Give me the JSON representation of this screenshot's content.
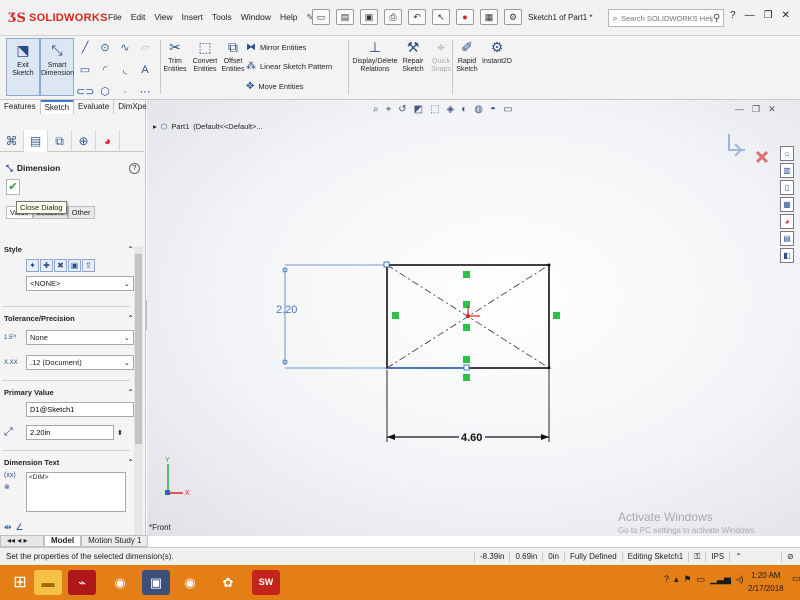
{
  "app": {
    "brand": "SOLIDWORKS",
    "document_title": "Sketch1 of Part1 *",
    "menu": [
      "File",
      "Edit",
      "View",
      "Insert",
      "Tools",
      "Window",
      "Help"
    ],
    "search_placeholder": "Search SOLIDWORKS Help"
  },
  "commands": {
    "exit_sketch": "Exit Sketch",
    "smart_dimension": "Smart Dimension",
    "trim": "Trim Entities",
    "convert": "Convert Entities",
    "offset": "Offset Entities",
    "mirror": "Mirror Entities",
    "linear_pattern": "Linear Sketch Pattern",
    "move": "Move Entities",
    "display_relations": "Display/Delete Relations",
    "repair": "Repair Sketch",
    "quick_snaps": "Quick Snaps",
    "rapid_sketch": "Rapid Sketch",
    "instant2d": "Instant2D"
  },
  "cm_tabs": [
    "Features",
    "Sketch",
    "Evaluate",
    "DimXpert"
  ],
  "active_cm_tab": "Sketch",
  "property_manager": {
    "title": "Dimension",
    "tooltip": "Close Dialog",
    "subtabs": [
      "Value",
      "Leaders",
      "Other"
    ],
    "style": {
      "label": "Style",
      "selected": "<NONE>"
    },
    "tolerance": {
      "label": "Tolerance/Precision",
      "tolerance_type": "None",
      "precision": ".12 (Document)"
    },
    "primary_value": {
      "label": "Primary Value",
      "name": "D1@Sketch1",
      "value": "2.20in"
    },
    "dimension_text": {
      "label": "Dimension Text",
      "text": "<DIM>"
    }
  },
  "tree": {
    "part": "Part1",
    "config": "(Default<<Default>..."
  },
  "sketch": {
    "dim_vertical": "2.20",
    "dim_horizontal": "4.60",
    "view_label": "*Front",
    "axis_x": "X",
    "axis_y": "Y"
  },
  "bottom_tabs": [
    "Model",
    "Motion Study 1"
  ],
  "active_bottom_tab": "Model",
  "status": {
    "message": "Set the properties of the selected dimension(s).",
    "x": "-8.39in",
    "y": "0.69in",
    "z": "0in",
    "definition": "Fully Defined",
    "mode": "Editing Sketch1",
    "units": "IPS"
  },
  "watermark": {
    "line1": "Activate Windows",
    "line2": "Go to PC settings to activate Windows."
  },
  "taskbar": {
    "time": "1:20 AM",
    "date": "2/17/2018"
  }
}
